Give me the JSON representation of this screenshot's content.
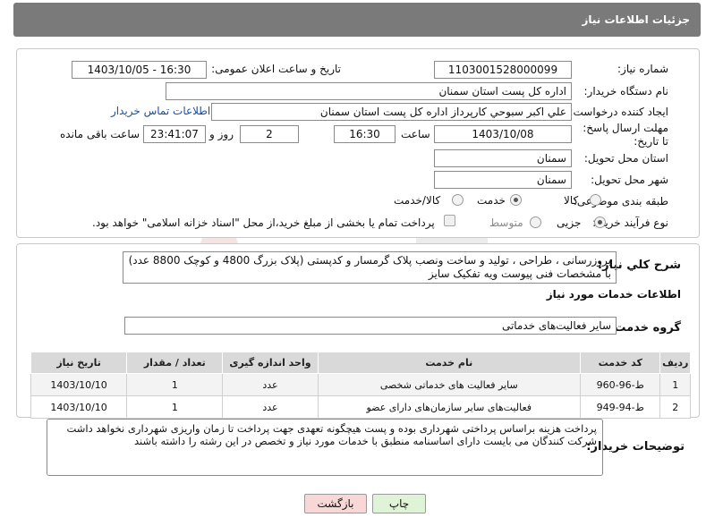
{
  "header": {
    "title": "جزئیات اطلاعات نیاز"
  },
  "form": {
    "need_number_label": "شماره نیاز:",
    "need_number": "1103001528000099",
    "announce_label": "تاریخ و ساعت اعلان عمومی:",
    "announce_value": "1403/10/05 - 16:30",
    "buyer_org_label": "نام دستگاه خریدار:",
    "buyer_org": "اداره کل پست استان سمنان",
    "creator_label": "ایجاد کننده درخواست:",
    "creator": "علي اکبر سبوحي کارپرداز اداره کل پست استان سمنان",
    "contact_link": "اطلاعات تماس خریدار",
    "deadline_label": "مهلت ارسال پاسخ: تا تاریخ:",
    "deadline_date": "1403/10/08",
    "time_label": "ساعت",
    "deadline_time": "16:30",
    "days_value": "2",
    "days_label": "روز و",
    "remaining_time": "23:41:07",
    "remaining_label": "ساعت باقی مانده",
    "province_label": "استان محل تحویل:",
    "province": "سمنان",
    "city_label": "شهر محل تحویل:",
    "city": "سمنان",
    "category_label": "طبقه بندی موضوعی:",
    "category_options": [
      "کالا",
      "خدمت",
      "کالا/خدمت"
    ],
    "category_selected": "خدمت",
    "process_label": "نوع فرآیند خرید :",
    "process_options": [
      "جزیی",
      "متوسط"
    ],
    "process_selected": "جزیی",
    "treasury_note": "پرداخت تمام یا بخشی از مبلغ خرید،از محل \"اسناد خزانه اسلامی\" خواهد بود."
  },
  "description": {
    "label": "شرح کلي نياز:",
    "text": "بروزرسانی ، طراحی ، تولید و ساخت ونصب پلاک گرمسار و کدپستی (پلاک بزرگ 4800 و کوچک 8800 عدد) با مشخصات فنی پیوست ویه تفکیک سایز"
  },
  "services": {
    "section_title": "اطلاعات خدمات مورد نیاز",
    "group_label": "گروه خدمت:",
    "group_value": "سایر فعالیت‌های خدماتی",
    "columns": [
      "ردیف",
      "کد خدمت",
      "نام خدمت",
      "واحد اندازه گیری",
      "تعداد / مقدار",
      "تاریخ نیاز"
    ],
    "rows": [
      [
        "1",
        "ط-96-960",
        "سایر فعالیت های خدماتی شخصی",
        "عدد",
        "1",
        "1403/10/10"
      ],
      [
        "2",
        "ط-94-949",
        "فعالیت‌های سایر سازمان‌های دارای عضو",
        "عدد",
        "1",
        "1403/10/10"
      ]
    ]
  },
  "buyer_notes": {
    "label": "توضیحات خریدار:",
    "line1": "پرداخت هزینه براساس پرداختی شهرداری بوده و پست هیچگونه تعهدی جهت پرداخت تا زمان واریزی شهرداری نخواهد داشت",
    "line2": "شرکت کنندگان می بایست دارای اساسنامه منطبق با خدمات مورد نیاز و تخصص در این رشته را داشته باشند"
  },
  "buttons": {
    "print": "چاپ",
    "back": "بازگشت"
  },
  "colors": {
    "header": "#7a7a7a",
    "link": "#1a4fa0",
    "back_button": "#f8d7d7",
    "print_button": "#dff3d6"
  }
}
